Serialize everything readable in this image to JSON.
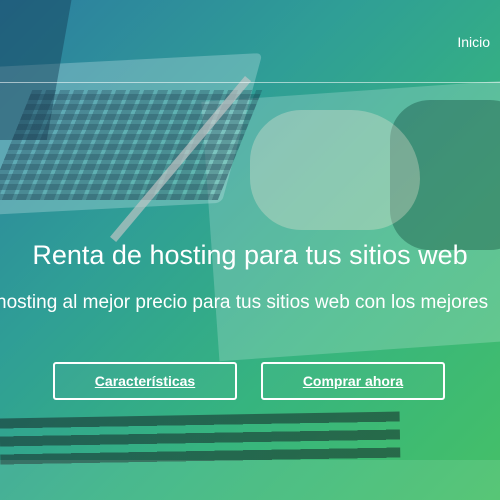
{
  "nav": {
    "inicio_label": "Inicio"
  },
  "hero": {
    "title": "Renta de hosting para tus sitios web",
    "subtitle": "hosting al mejor precio para tus sitios web con los mejores",
    "buttons": {
      "features_label": "Características",
      "buy_label": "Comprar ahora"
    },
    "background_image": "laptop-hand-pencil-notes-photo"
  },
  "colors": {
    "gradient_start": "#2c7da0",
    "gradient_mid": "#2f9e96",
    "gradient_end": "#45c067",
    "text": "#ffffff"
  }
}
